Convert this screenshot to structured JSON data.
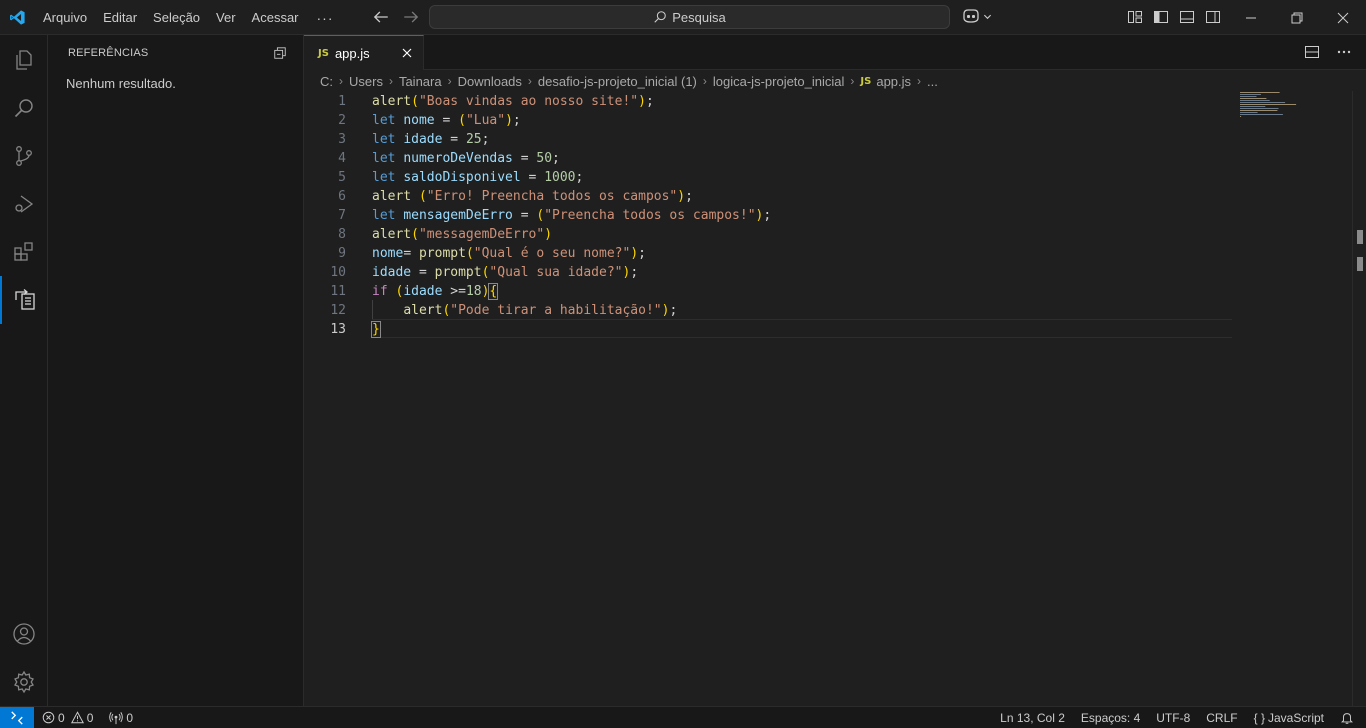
{
  "menu": {
    "items": [
      "Arquivo",
      "Editar",
      "Seleção",
      "Ver",
      "Acessar"
    ],
    "more": "···"
  },
  "search": {
    "label": "Pesquisa"
  },
  "sidebar": {
    "title": "REFERÊNCIAS",
    "empty_message": "Nenhum resultado."
  },
  "tab": {
    "badge": "JS",
    "label": "app.js"
  },
  "breadcrumb": {
    "parts": [
      "C:",
      "Users",
      "Tainara",
      "Downloads",
      "desafio-js-projeto_inicial (1)",
      "logica-js-projeto_inicial"
    ],
    "file_badge": "JS",
    "file": "app.js",
    "ellipsis": "..."
  },
  "editor": {
    "line_numbers": [
      "1",
      "2",
      "3",
      "4",
      "5",
      "6",
      "7",
      "8",
      "9",
      "10",
      "11",
      "12",
      "13"
    ],
    "current_line": 13,
    "lines": [
      [
        {
          "t": "fn",
          "v": "alert"
        },
        {
          "t": "p",
          "v": "("
        },
        {
          "t": "str",
          "v": "\"Boas vindas ao nosso site!\""
        },
        {
          "t": "p",
          "v": ")"
        },
        {
          "t": "plain",
          "v": ";"
        }
      ],
      [
        {
          "t": "kw",
          "v": "let"
        },
        {
          "t": "plain",
          "v": " "
        },
        {
          "t": "var",
          "v": "nome"
        },
        {
          "t": "plain",
          "v": " = "
        },
        {
          "t": "p",
          "v": "("
        },
        {
          "t": "str",
          "v": "\"Lua\""
        },
        {
          "t": "p",
          "v": ")"
        },
        {
          "t": "plain",
          "v": ";"
        }
      ],
      [
        {
          "t": "kw",
          "v": "let"
        },
        {
          "t": "plain",
          "v": " "
        },
        {
          "t": "var",
          "v": "idade"
        },
        {
          "t": "plain",
          "v": " = "
        },
        {
          "t": "num",
          "v": "25"
        },
        {
          "t": "plain",
          "v": ";"
        }
      ],
      [
        {
          "t": "kw",
          "v": "let"
        },
        {
          "t": "plain",
          "v": " "
        },
        {
          "t": "var",
          "v": "numeroDeVendas"
        },
        {
          "t": "plain",
          "v": " = "
        },
        {
          "t": "num",
          "v": "50"
        },
        {
          "t": "plain",
          "v": ";"
        }
      ],
      [
        {
          "t": "kw",
          "v": "let"
        },
        {
          "t": "plain",
          "v": " "
        },
        {
          "t": "var",
          "v": "saldoDisponivel"
        },
        {
          "t": "plain",
          "v": " = "
        },
        {
          "t": "num",
          "v": "1000"
        },
        {
          "t": "plain",
          "v": ";"
        }
      ],
      [
        {
          "t": "fn",
          "v": "alert"
        },
        {
          "t": "plain",
          "v": " "
        },
        {
          "t": "p",
          "v": "("
        },
        {
          "t": "str",
          "v": "\"Erro! Preencha todos os campos\""
        },
        {
          "t": "p",
          "v": ")"
        },
        {
          "t": "plain",
          "v": ";"
        }
      ],
      [
        {
          "t": "kw",
          "v": "let"
        },
        {
          "t": "plain",
          "v": " "
        },
        {
          "t": "var",
          "v": "mensagemDeErro"
        },
        {
          "t": "plain",
          "v": " = "
        },
        {
          "t": "p",
          "v": "("
        },
        {
          "t": "str",
          "v": "\"Preencha todos os campos!\""
        },
        {
          "t": "p",
          "v": ")"
        },
        {
          "t": "plain",
          "v": ";"
        }
      ],
      [
        {
          "t": "fn",
          "v": "alert"
        },
        {
          "t": "p",
          "v": "("
        },
        {
          "t": "str",
          "v": "\"messagemDeErro\""
        },
        {
          "t": "p",
          "v": ")"
        }
      ],
      [
        {
          "t": "var",
          "v": "nome"
        },
        {
          "t": "plain",
          "v": "= "
        },
        {
          "t": "fn",
          "v": "prompt"
        },
        {
          "t": "p",
          "v": "("
        },
        {
          "t": "str",
          "v": "\"Qual é o seu nome?\""
        },
        {
          "t": "p",
          "v": ")"
        },
        {
          "t": "plain",
          "v": ";"
        }
      ],
      [
        {
          "t": "var",
          "v": "idade"
        },
        {
          "t": "plain",
          "v": " = "
        },
        {
          "t": "fn",
          "v": "prompt"
        },
        {
          "t": "p",
          "v": "("
        },
        {
          "t": "str",
          "v": "\"Qual sua idade?\""
        },
        {
          "t": "p",
          "v": ")"
        },
        {
          "t": "plain",
          "v": ";"
        }
      ],
      [
        {
          "t": "kw2",
          "v": "if"
        },
        {
          "t": "plain",
          "v": " "
        },
        {
          "t": "p",
          "v": "("
        },
        {
          "t": "var",
          "v": "idade"
        },
        {
          "t": "plain",
          "v": " >="
        },
        {
          "t": "num",
          "v": "18"
        },
        {
          "t": "p",
          "v": ")"
        },
        {
          "t": "p",
          "v": "{"
        }
      ],
      [
        {
          "t": "plain",
          "v": "    "
        },
        {
          "t": "fn",
          "v": "alert"
        },
        {
          "t": "p",
          "v": "("
        },
        {
          "t": "str",
          "v": "\"Pode tirar a habilitação!\""
        },
        {
          "t": "p",
          "v": ")"
        },
        {
          "t": "plain",
          "v": ";"
        }
      ],
      [
        {
          "t": "p",
          "v": "}"
        }
      ]
    ]
  },
  "statusbar": {
    "errors": "0",
    "warnings": "0",
    "ports": "0",
    "cursor": "Ln 13, Col 2",
    "spaces": "Espaços: 4",
    "encoding": "UTF-8",
    "eol": "CRLF",
    "language_badge": "{ }",
    "language": "JavaScript"
  },
  "colors": {
    "accent": "#0078d4",
    "js_badge": "#cbcb41"
  },
  "icons": [
    "vscode-logo-icon",
    "arrow-left-icon",
    "arrow-right-icon",
    "search-icon",
    "copilot-icon",
    "chevron-down-icon",
    "toggle-primary-sidebar-icon",
    "toggle-panel-icon",
    "toggle-secondary-sidebar-icon",
    "customize-layout-icon",
    "minimize-icon",
    "restore-icon",
    "close-icon",
    "explorer-icon",
    "search-view-icon",
    "source-control-icon",
    "run-debug-icon",
    "extensions-icon",
    "references-icon",
    "accounts-icon",
    "manage-gear-icon",
    "collapse-all-icon",
    "split-editor-icon",
    "more-actions-icon",
    "remote-icon",
    "error-icon",
    "warning-icon",
    "ports-icon",
    "bell-icon"
  ]
}
